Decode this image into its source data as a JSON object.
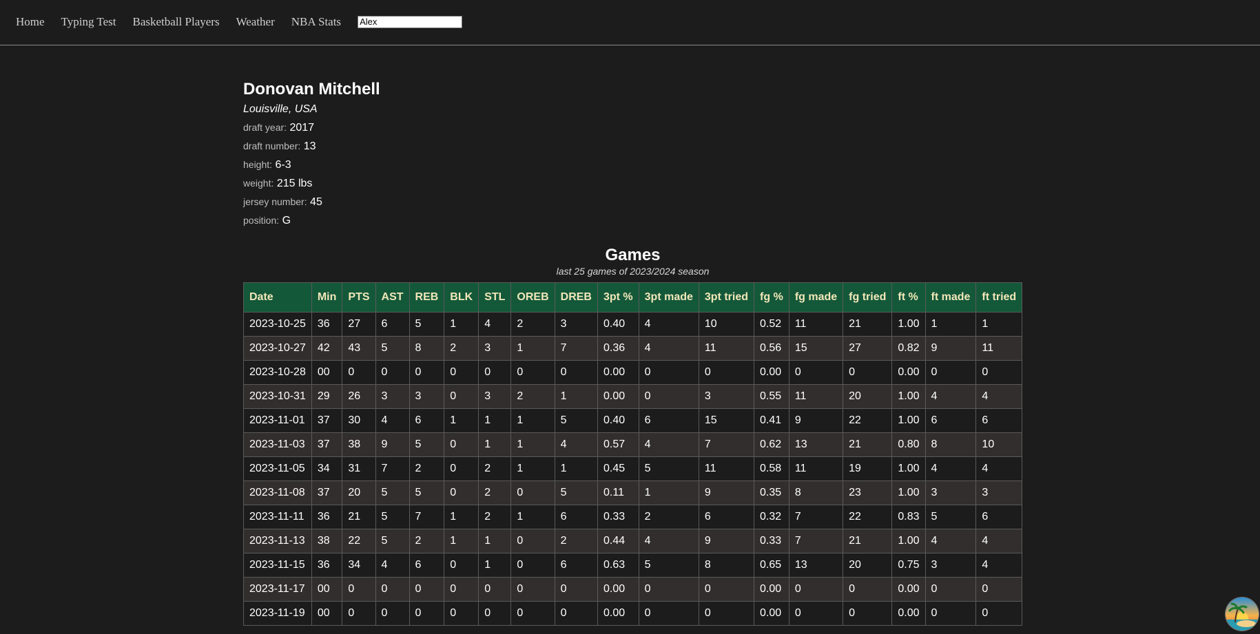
{
  "nav": {
    "links": [
      "Home",
      "Typing Test",
      "Basketball Players",
      "Weather",
      "NBA Stats"
    ],
    "search_value": "Alex"
  },
  "player": {
    "name": "Donovan Mitchell",
    "origin": "Louisville, USA",
    "draft_year_label": "draft year:",
    "draft_year": "2017",
    "draft_number_label": "draft number:",
    "draft_number": "13",
    "height_label": "height:",
    "height": "6-3",
    "weight_label": "weight:",
    "weight": "215 lbs",
    "jersey_label": "jersey number:",
    "jersey": "45",
    "position_label": "position:",
    "position": "G"
  },
  "games": {
    "title": "Games",
    "subtitle": "last 25 games of 2023/2024 season",
    "columns": [
      "Date",
      "Min",
      "PTS",
      "AST",
      "REB",
      "BLK",
      "STL",
      "OREB",
      "DREB",
      "3pt %",
      "3pt made",
      "3pt tried",
      "fg %",
      "fg made",
      "fg tried",
      "ft %",
      "ft made",
      "ft tried"
    ],
    "rows": [
      [
        "2023-10-25",
        "36",
        "27",
        "6",
        "5",
        "1",
        "4",
        "2",
        "3",
        "0.40",
        "4",
        "10",
        "0.52",
        "11",
        "21",
        "1.00",
        "1",
        "1"
      ],
      [
        "2023-10-27",
        "42",
        "43",
        "5",
        "8",
        "2",
        "3",
        "1",
        "7",
        "0.36",
        "4",
        "11",
        "0.56",
        "15",
        "27",
        "0.82",
        "9",
        "11"
      ],
      [
        "2023-10-28",
        "00",
        "0",
        "0",
        "0",
        "0",
        "0",
        "0",
        "0",
        "0.00",
        "0",
        "0",
        "0.00",
        "0",
        "0",
        "0.00",
        "0",
        "0"
      ],
      [
        "2023-10-31",
        "29",
        "26",
        "3",
        "3",
        "0",
        "3",
        "2",
        "1",
        "0.00",
        "0",
        "3",
        "0.55",
        "11",
        "20",
        "1.00",
        "4",
        "4"
      ],
      [
        "2023-11-01",
        "37",
        "30",
        "4",
        "6",
        "1",
        "1",
        "1",
        "5",
        "0.40",
        "6",
        "15",
        "0.41",
        "9",
        "22",
        "1.00",
        "6",
        "6"
      ],
      [
        "2023-11-03",
        "37",
        "38",
        "9",
        "5",
        "0",
        "1",
        "1",
        "4",
        "0.57",
        "4",
        "7",
        "0.62",
        "13",
        "21",
        "0.80",
        "8",
        "10"
      ],
      [
        "2023-11-05",
        "34",
        "31",
        "7",
        "2",
        "0",
        "2",
        "1",
        "1",
        "0.45",
        "5",
        "11",
        "0.58",
        "11",
        "19",
        "1.00",
        "4",
        "4"
      ],
      [
        "2023-11-08",
        "37",
        "20",
        "5",
        "5",
        "0",
        "2",
        "0",
        "5",
        "0.11",
        "1",
        "9",
        "0.35",
        "8",
        "23",
        "1.00",
        "3",
        "3"
      ],
      [
        "2023-11-11",
        "36",
        "21",
        "5",
        "7",
        "1",
        "2",
        "1",
        "6",
        "0.33",
        "2",
        "6",
        "0.32",
        "7",
        "22",
        "0.83",
        "5",
        "6"
      ],
      [
        "2023-11-13",
        "38",
        "22",
        "5",
        "2",
        "1",
        "1",
        "0",
        "2",
        "0.44",
        "4",
        "9",
        "0.33",
        "7",
        "21",
        "1.00",
        "4",
        "4"
      ],
      [
        "2023-11-15",
        "36",
        "34",
        "4",
        "6",
        "0",
        "1",
        "0",
        "6",
        "0.63",
        "5",
        "8",
        "0.65",
        "13",
        "20",
        "0.75",
        "3",
        "4"
      ],
      [
        "2023-11-17",
        "00",
        "0",
        "0",
        "0",
        "0",
        "0",
        "0",
        "0",
        "0.00",
        "0",
        "0",
        "0.00",
        "0",
        "0",
        "0.00",
        "0",
        "0"
      ],
      [
        "2023-11-19",
        "00",
        "0",
        "0",
        "0",
        "0",
        "0",
        "0",
        "0",
        "0.00",
        "0",
        "0",
        "0.00",
        "0",
        "0",
        "0.00",
        "0",
        "0"
      ]
    ]
  },
  "colors": {
    "background": "#1c1c1c",
    "header_bg": "#14583a",
    "header_text": "#f1e7b8",
    "row_alt": "#332e2e"
  },
  "icons": {
    "floating_button": "beach-sunset-icon"
  }
}
